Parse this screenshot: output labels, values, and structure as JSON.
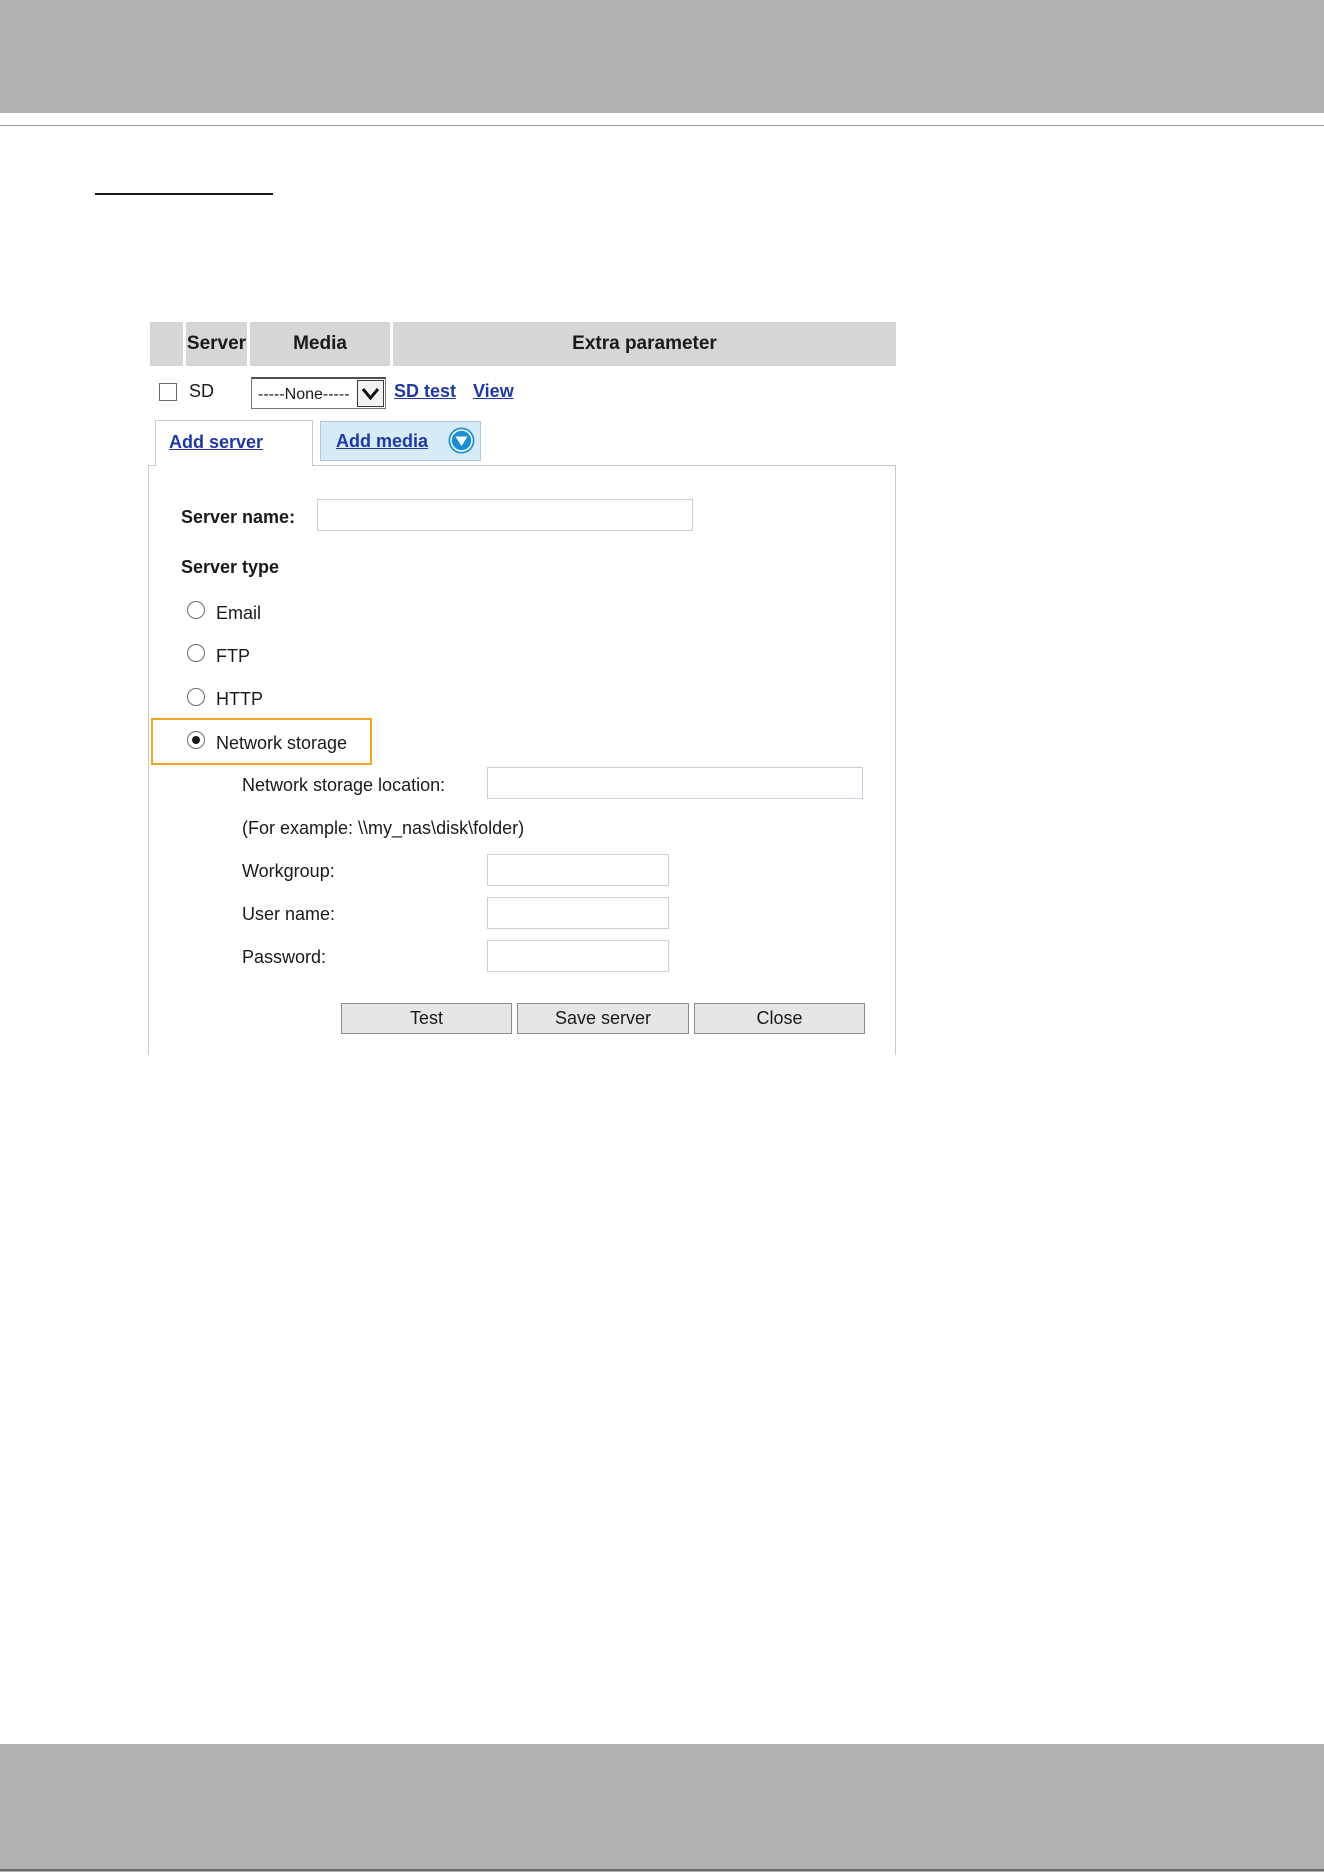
{
  "table_header": {
    "server": "Server",
    "media": "Media",
    "extra_parameter": "Extra parameter"
  },
  "sd_row": {
    "label": "SD",
    "checked": false,
    "media_selected": "-----None-----",
    "links": {
      "sd_test": "SD test",
      "view": "View"
    }
  },
  "tabs": {
    "add_server": "Add server",
    "add_media": "Add media"
  },
  "form": {
    "server_name_label": "Server name:",
    "server_name_value": "",
    "server_type_label": "Server type",
    "server_types": [
      "Email",
      "FTP",
      "HTTP",
      "Network storage"
    ],
    "selected_type": "Network storage",
    "network_storage": {
      "location_label": "Network storage location:",
      "location_value": "",
      "example": "(For example: \\\\my_nas\\disk\\folder)",
      "workgroup_label": "Workgroup:",
      "workgroup_value": "",
      "username_label": "User name:",
      "username_value": "",
      "password_label": "Password:",
      "password_value": ""
    },
    "buttons": {
      "test": "Test",
      "save": "Save server",
      "close": "Close"
    }
  },
  "icons": {
    "select_arrow": "chevron-down-icon",
    "add_media_dropdown": "circle-chevron-down-icon"
  },
  "colors": {
    "link": "#1f38a4",
    "highlight": "#f2a51e",
    "header_bg": "#d6d6d6",
    "band_bg": "#b1b2b4",
    "tab_media_bg": "#d7ebf7",
    "dropdown_icon": "#1b8fd3"
  }
}
